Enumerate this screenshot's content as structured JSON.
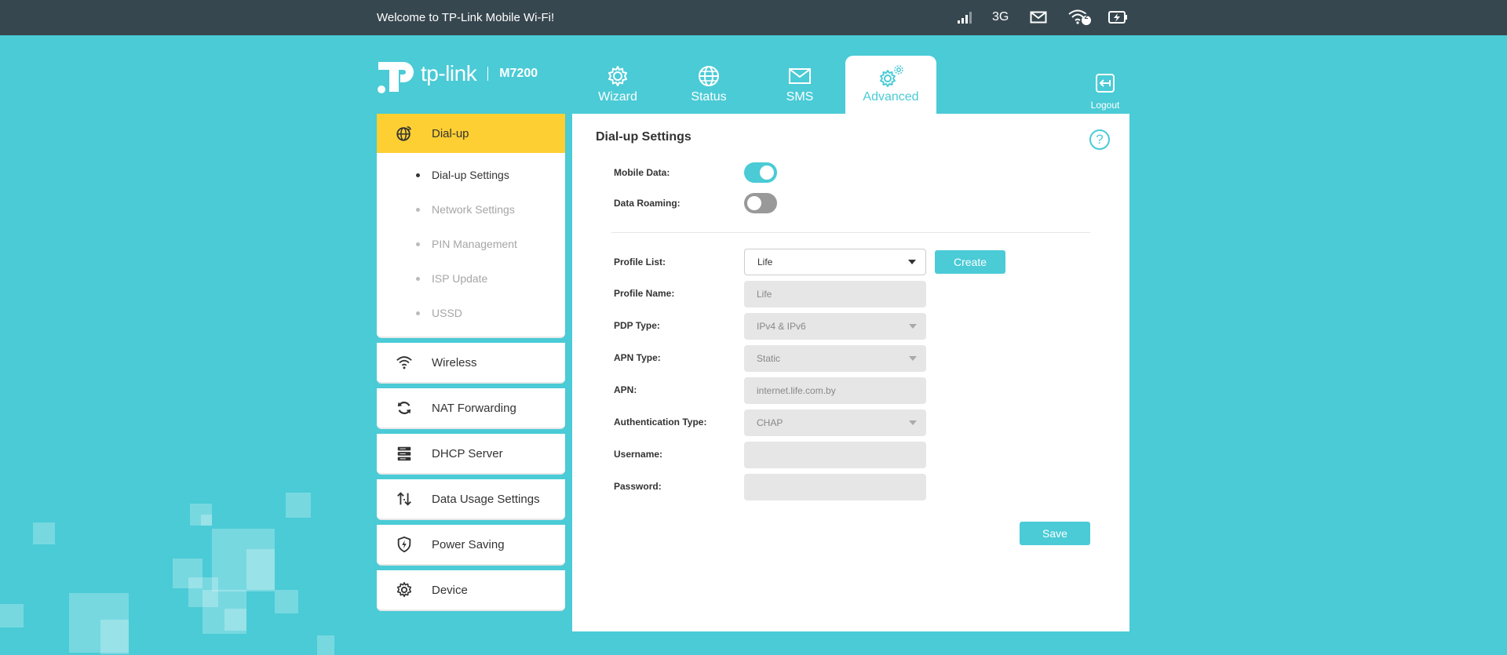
{
  "topbar": {
    "welcome": "Welcome to TP-Link Mobile Wi-Fi!",
    "network_type": "3G",
    "wifi_clients": "2",
    "icons": [
      "signal-icon",
      "mail-icon",
      "wifi-icon",
      "battery-icon"
    ]
  },
  "header": {
    "brand": "tp-link",
    "model": "M7200",
    "tabs": [
      {
        "label": "Wizard",
        "icon": "gear-icon"
      },
      {
        "label": "Status",
        "icon": "globe-icon"
      },
      {
        "label": "SMS",
        "icon": "mail-icon"
      },
      {
        "label": "Advanced",
        "icon": "gears-icon",
        "active": true
      }
    ],
    "logout": "Logout"
  },
  "sidebar": {
    "groups": [
      {
        "label": "Dial-up",
        "icon": "globe-dialup-icon",
        "active": true,
        "items": [
          {
            "label": "Dial-up Settings",
            "active": true
          },
          {
            "label": "Network Settings"
          },
          {
            "label": "PIN Management"
          },
          {
            "label": "ISP Update"
          },
          {
            "label": "USSD"
          }
        ]
      },
      {
        "label": "Wireless",
        "icon": "wifi-icon"
      },
      {
        "label": "NAT Forwarding",
        "icon": "nat-icon"
      },
      {
        "label": "DHCP Server",
        "icon": "server-icon"
      },
      {
        "label": "Data Usage Settings",
        "icon": "data-usage-icon"
      },
      {
        "label": "Power Saving",
        "icon": "shield-icon"
      },
      {
        "label": "Device",
        "icon": "gear-icon"
      }
    ]
  },
  "main": {
    "title": "Dial-up Settings",
    "mobile_data": {
      "label": "Mobile Data:",
      "on": true
    },
    "data_roaming": {
      "label": "Data Roaming:",
      "on": false
    },
    "profile_list": {
      "label": "Profile List:",
      "value": "Life"
    },
    "create_label": "Create",
    "profile_name": {
      "label": "Profile Name:",
      "value": "Life"
    },
    "pdp_type": {
      "label": "PDP Type:",
      "value": "IPv4 & IPv6"
    },
    "apn_type": {
      "label": "APN Type:",
      "value": "Static"
    },
    "apn": {
      "label": "APN:",
      "value": "internet.life.com.by"
    },
    "auth_type": {
      "label": "Authentication Type:",
      "value": "CHAP"
    },
    "username": {
      "label": "Username:",
      "value": ""
    },
    "password": {
      "label": "Password:",
      "value": ""
    },
    "save_label": "Save",
    "help_label": "?"
  },
  "colors": {
    "accent": "#4acbd6",
    "active_menu": "#fdcf33",
    "topbar": "#37474f"
  }
}
